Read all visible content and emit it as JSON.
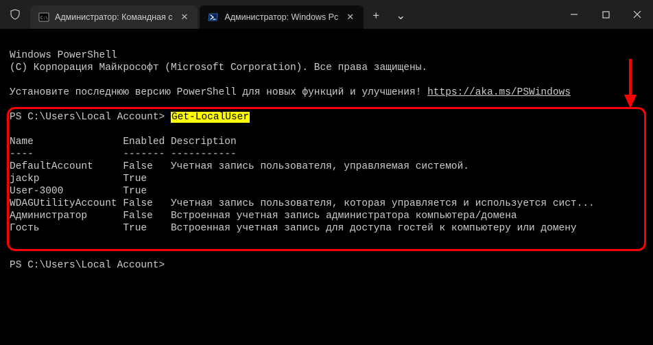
{
  "titlebar": {
    "tab1_label": "Администратор: Командная с",
    "tab2_label": "Администратор: Windows Pc",
    "plus": "+",
    "chevron": "⌄",
    "minimize": "—",
    "maximize": "▢",
    "close": "✕"
  },
  "body": {
    "line1": "Windows PowerShell",
    "line2": "(C) Корпорация Майкрософт (Microsoft Corporation). Все права защищены.",
    "line3a": "Установите последнюю версию PowerShell для новых функций и улучшения! ",
    "line3b": "https://aka.ms/PSWindows",
    "prompt1_pre": "PS C:\\Users\\Local Account> ",
    "prompt1_cmd": "Get-LocalUser",
    "header": "Name               Enabled Description",
    "divider": "----               ------- -----------",
    "rows": [
      "DefaultAccount     False   Учетная запись пользователя, управляемая системой.",
      "jackp              True",
      "User-3000          True",
      "WDAGUtilityAccount False   Учетная запись пользователя, которая управляется и используется сист...",
      "Администратор      False   Встроенная учетная запись администратора компьютера/домена",
      "Гость              True    Встроенная учетная запись для доступа гостей к компьютеру или домену"
    ],
    "prompt2": "PS C:\\Users\\Local Account>"
  },
  "chart_data": {
    "type": "table",
    "title": "Get-LocalUser output",
    "columns": [
      "Name",
      "Enabled",
      "Description"
    ],
    "rows": [
      [
        "DefaultAccount",
        "False",
        "Учетная запись пользователя, управляемая системой."
      ],
      [
        "jackp",
        "True",
        ""
      ],
      [
        "User-3000",
        "True",
        ""
      ],
      [
        "WDAGUtilityAccount",
        "False",
        "Учетная запись пользователя, которая управляется и используется сист..."
      ],
      [
        "Администратор",
        "False",
        "Встроенная учетная запись администратора компьютера/домена"
      ],
      [
        "Гость",
        "True",
        "Встроенная учетная запись для доступа гостей к компьютеру или домену"
      ]
    ]
  }
}
